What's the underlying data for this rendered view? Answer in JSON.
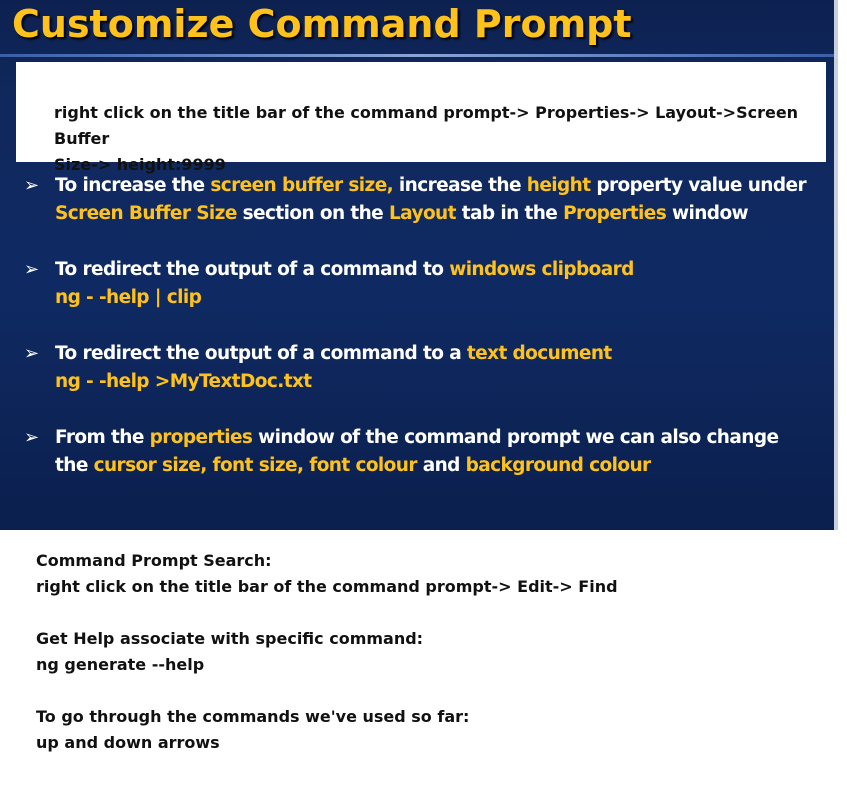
{
  "slide": {
    "title": "Customize Command Prompt",
    "note": {
      "line1": "right click on the title bar of the command prompt-> Properties-> Layout->Screen Buffer",
      "line2": "Size-> height:9999"
    },
    "bullets": [
      {
        "l1": [
          "To increase the ",
          "screen buffer size,",
          " increase the ",
          "height",
          " property value under"
        ],
        "l2": [
          "Screen Buffer Size",
          " section on the ",
          "Layout",
          " tab in the ",
          "Properties",
          " window"
        ]
      },
      {
        "l1": [
          "To redirect the output of a command to ",
          "windows clipboard"
        ],
        "l2": [
          "ng - -help | clip"
        ]
      },
      {
        "l1": [
          "To redirect the output of a command to a ",
          "text document"
        ],
        "l2": [
          "ng - -help >MyTextDoc.txt"
        ]
      },
      {
        "l1": [
          "From the ",
          "properties",
          " window of the command prompt we can also change"
        ],
        "l2": [
          "the ",
          "cursor size, font size, font colour",
          " and ",
          "background colour"
        ]
      }
    ]
  },
  "notes": [
    {
      "heading": "Command Prompt Search:",
      "text": "right click on the title bar of the command prompt-> Edit-> Find"
    },
    {
      "heading": "Get Help associate with specific command:",
      "text": "ng generate --help"
    },
    {
      "heading": "To go through the commands we've used so far:",
      "text": "up and down arrows"
    }
  ],
  "colors": {
    "highlight": "#ffc21a",
    "slide_background": "#0f2a63",
    "text_on_slide": "#ffffff"
  },
  "icons": {
    "bullet": "arrow-bullet-icon"
  }
}
